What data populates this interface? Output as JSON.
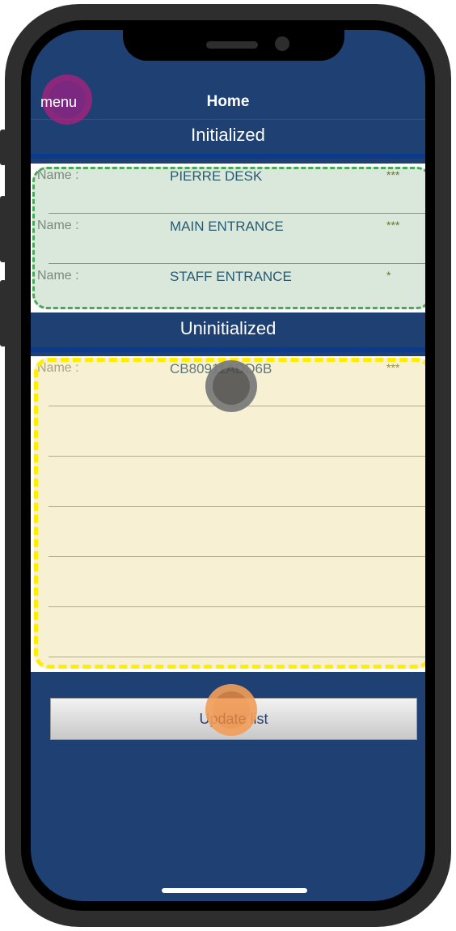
{
  "nav": {
    "menu_label": "menu",
    "title": "Home"
  },
  "initialized": {
    "header": "Initialized",
    "items": [
      {
        "label": "Name :",
        "name": "PIERRE DESK",
        "signal": "***"
      },
      {
        "label": "Name :",
        "name": "MAIN ENTRANCE",
        "signal": "***"
      },
      {
        "label": "Name :",
        "name": "STAFF ENTRANCE",
        "signal": "*"
      }
    ]
  },
  "uninitialized": {
    "header": "Uninitialized",
    "items": [
      {
        "label": "Name :",
        "name": "CB80911ADD6B",
        "signal": "***"
      }
    ]
  },
  "actions": {
    "update_label": "Update list"
  },
  "colors": {
    "background": "#1e4072",
    "header_underline": "#0b3a8a",
    "item_text": "#1f4e79",
    "signal_text": "#7a7400",
    "separator": "#c98a5a"
  }
}
